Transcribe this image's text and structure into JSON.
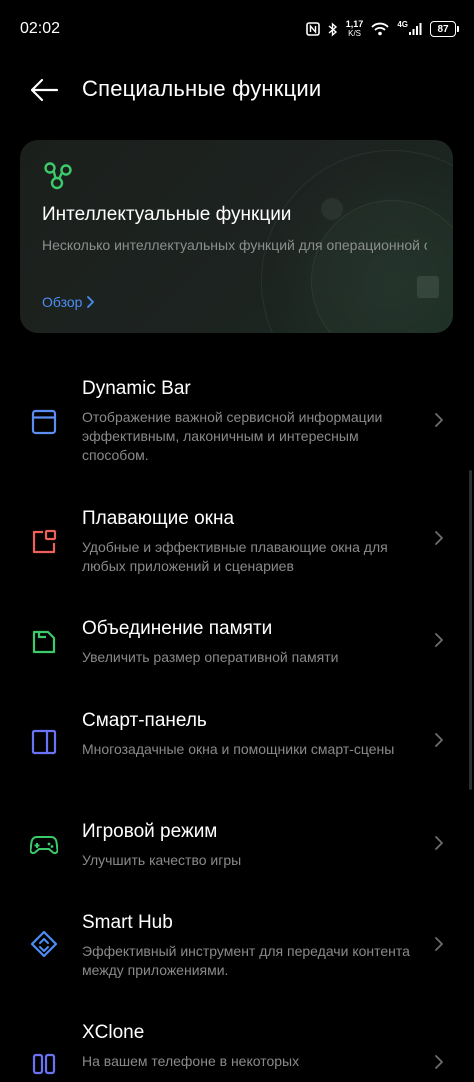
{
  "status_bar": {
    "time": "02:02",
    "net_speed_value": "1,17",
    "net_speed_unit": "K/S",
    "network_type": "4G",
    "battery": "87"
  },
  "header": {
    "title": "Специальные функции"
  },
  "banner": {
    "title": "Интеллектуальные функции",
    "description": "Несколько интеллектуальных функций для операционной системы, которая понимает все ва...",
    "link": "Обзор"
  },
  "items": [
    {
      "title": "Dynamic Bar",
      "subtitle": "Отображение важной сервисной информации эффективным, лаконичным и интересным способом.",
      "icon": "dynamic-bar-icon",
      "color": "#5b8df2"
    },
    {
      "title": "Плавающие окна",
      "subtitle": "Удобные и эффективные плавающие окна для любых приложений и сценариев",
      "icon": "floating-window-icon",
      "color": "#f0605a"
    },
    {
      "title": "Объединение памяти",
      "subtitle": "Увеличить размер оперативной памяти",
      "icon": "memory-card-icon",
      "color": "#3ccb6b"
    },
    {
      "title": "Смарт-панель",
      "subtitle": "Многозадачные окна и помощники смарт-сцены",
      "icon": "smart-panel-icon",
      "color": "#6a72f5"
    },
    {
      "title": "Игровой режим",
      "subtitle": "Улучшить качество игры",
      "icon": "gamepad-icon",
      "color": "#3ccb6b"
    },
    {
      "title": "Smart Hub",
      "subtitle": "Эффективный инструмент для передачи контента между приложениями.",
      "icon": "smart-hub-icon",
      "color": "#4d8ef5"
    },
    {
      "title": "XClone",
      "subtitle": "На вашем телефоне в некоторых",
      "icon": "xclone-icon",
      "color": "#6a72f5"
    }
  ]
}
